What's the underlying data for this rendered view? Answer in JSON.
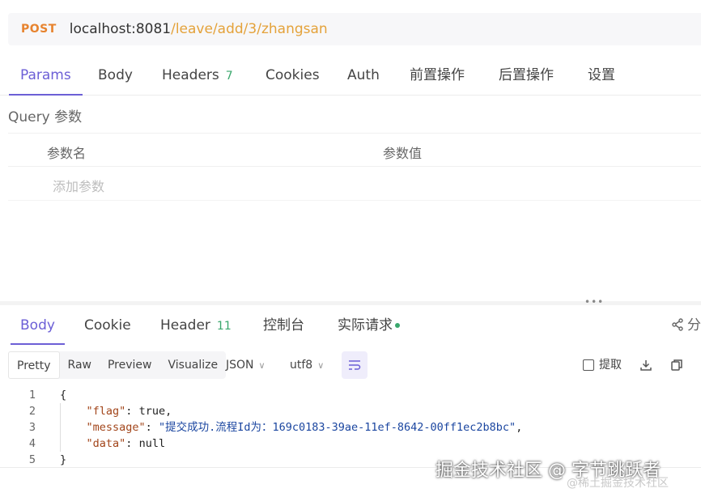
{
  "request": {
    "method": "POST",
    "url_host": "localhost:8081",
    "url_path": "/leave/add/3/zhangsan"
  },
  "request_tabs": {
    "params": "Params",
    "body": "Body",
    "headers": "Headers",
    "headers_count": "7",
    "cookies": "Cookies",
    "auth": "Auth",
    "pre_ops": "前置操作",
    "post_ops": "后置操作",
    "settings": "设置"
  },
  "query": {
    "title": "Query 参数",
    "col_name": "参数名",
    "col_value": "参数值",
    "add_placeholder": "添加参数"
  },
  "response_tabs": {
    "body": "Body",
    "cookie": "Cookie",
    "header": "Header",
    "header_count": "11",
    "console": "控制台",
    "actual_request": "实际请求",
    "share": "分"
  },
  "toolbar": {
    "pretty": "Pretty",
    "raw": "Raw",
    "preview": "Preview",
    "visualize": "Visualize",
    "format": "JSON",
    "encoding": "utf8",
    "extract": "提取"
  },
  "code": {
    "line_numbers": [
      "1",
      "2",
      "3",
      "4",
      "5"
    ],
    "open_brace": "{",
    "flag_key": "\"flag\"",
    "flag_val": "true",
    "message_key": "\"message\"",
    "message_val": "\"提交成功.流程Id为：169c0183-39ae-11ef-8642-00ff1ec2b8bc\"",
    "data_key": "\"data\"",
    "data_val": "null",
    "close_brace": "}"
  },
  "watermark": {
    "main": "掘金技术社区 @ 字节跳跃者",
    "sub": "@稀土掘金技术社区"
  },
  "colors": {
    "accent": "#6c5fd6",
    "method": "#e7832e",
    "path": "#e4a23a",
    "count": "#3aa76d"
  }
}
